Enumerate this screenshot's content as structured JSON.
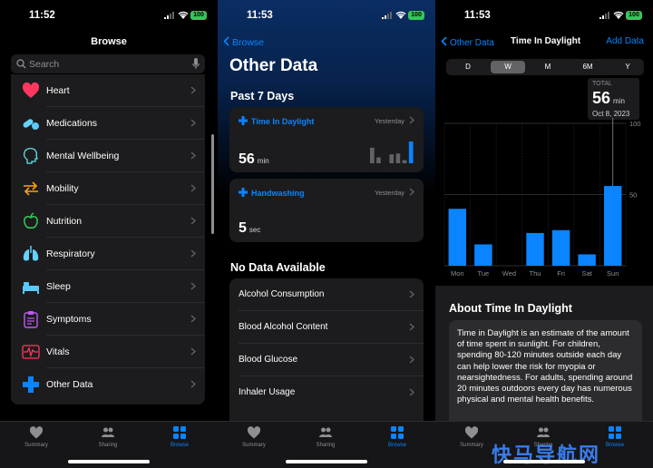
{
  "panel1": {
    "status_time": "11:52",
    "battery": "100",
    "title": "Browse",
    "search_placeholder": "Search",
    "categories": [
      {
        "label": "Heart",
        "icon": "heart-icon"
      },
      {
        "label": "Medications",
        "icon": "pill-icon"
      },
      {
        "label": "Mental Wellbeing",
        "icon": "head-icon"
      },
      {
        "label": "Mobility",
        "icon": "arrows-icon"
      },
      {
        "label": "Nutrition",
        "icon": "apple-icon"
      },
      {
        "label": "Respiratory",
        "icon": "lungs-icon"
      },
      {
        "label": "Sleep",
        "icon": "bed-icon"
      },
      {
        "label": "Symptoms",
        "icon": "clipboard-icon"
      },
      {
        "label": "Vitals",
        "icon": "waveform-icon"
      },
      {
        "label": "Other Data",
        "icon": "plus-icon"
      }
    ]
  },
  "panel2": {
    "status_time": "11:53",
    "battery": "100",
    "back_label": "Browse",
    "title": "Other Data",
    "past_header": "Past 7 Days",
    "cards": [
      {
        "name": "Time In Daylight",
        "when": "Yesterday",
        "value": "56",
        "unit": "min"
      },
      {
        "name": "Handwashing",
        "when": "Yesterday",
        "value": "5",
        "unit": "sec"
      }
    ],
    "no_data_header": "No Data Available",
    "no_data_items": [
      "Alcohol Consumption",
      "Blood Alcohol Content",
      "Blood Glucose",
      "Inhaler Usage"
    ]
  },
  "panel3": {
    "status_time": "11:53",
    "battery": "100",
    "back_label": "Other Data",
    "title": "Time In Daylight",
    "add_label": "Add Data",
    "ranges": [
      "D",
      "W",
      "M",
      "6M",
      "Y"
    ],
    "selected_range": "W",
    "tooltip": {
      "label": "TOTAL",
      "value": "56",
      "unit": "min",
      "date": "Oct 8, 2023"
    },
    "about_title": "About Time In Daylight",
    "about_text": "Time in Daylight is an estimate of the amount of time spent in sunlight. For children, spending 80-120 minutes outside each day can help lower the risk for myopia or nearsightedness. For adults, spending around 20 minutes outdoors every day has numerous physical and mental health benefits."
  },
  "tabbar": {
    "summary": "Summary",
    "sharing": "Sharing",
    "browse": "Browse"
  },
  "watermark": "快马导航网",
  "chart_data": {
    "type": "bar",
    "categories": [
      "Mon",
      "Tue",
      "Wed",
      "Thu",
      "Fri",
      "Sat",
      "Sun"
    ],
    "values": [
      40,
      15,
      0,
      23,
      25,
      8,
      56
    ],
    "ylim": [
      0,
      100
    ],
    "yticks": [
      0,
      50,
      100
    ],
    "grid": true,
    "color": "#0a84ff"
  }
}
